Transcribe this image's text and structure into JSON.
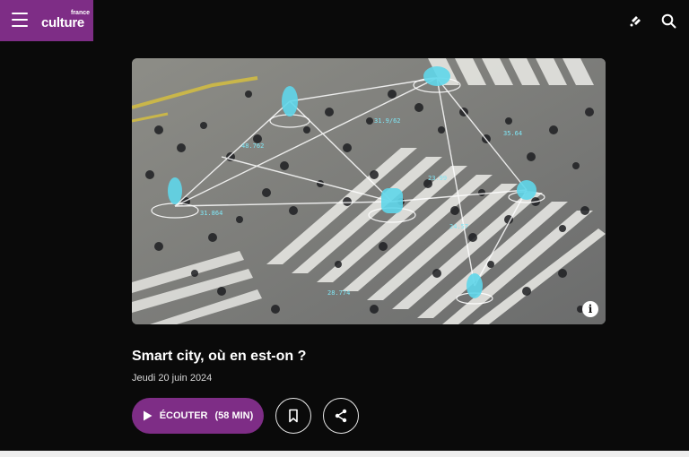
{
  "brand": {
    "small": "france",
    "name": "culture",
    "color": "#7e2d86"
  },
  "header": {
    "icons": [
      "menu-icon",
      "radio-icon",
      "search-icon"
    ]
  },
  "hero": {
    "image_labels": [
      "31.9/62",
      "31.864",
      "48.762",
      "35.64",
      "23.99",
      "28.774",
      "24.57"
    ]
  },
  "episode": {
    "title": "Smart city, où en est-on ?",
    "date": "Jeudi 20 juin 2024"
  },
  "actions": {
    "listen_label": "ÉCOUTER",
    "listen_duration": "(58 MIN)"
  }
}
